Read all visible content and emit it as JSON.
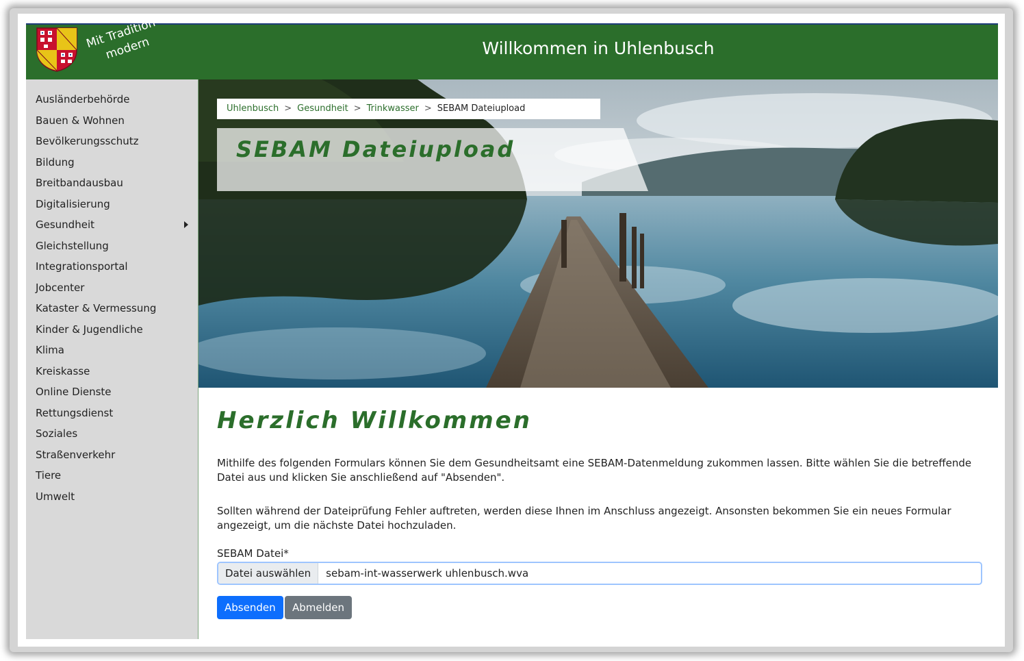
{
  "header": {
    "slogan_line1": "Mit Tradition",
    "slogan_line2": "modern",
    "title": "Willkommen in Uhlenbusch",
    "brand_color": "#2b6e2b"
  },
  "sidebar": {
    "items": [
      {
        "label": "Ausländerbehörde"
      },
      {
        "label": "Bauen & Wohnen"
      },
      {
        "label": "Bevölkerungsschutz"
      },
      {
        "label": "Bildung"
      },
      {
        "label": "Breitbandausbau"
      },
      {
        "label": "Digitalisierung"
      },
      {
        "label": "Gesundheit",
        "has_submenu": true
      },
      {
        "label": "Gleichstellung"
      },
      {
        "label": "Integrationsportal"
      },
      {
        "label": "Jobcenter"
      },
      {
        "label": "Kataster & Vermessung"
      },
      {
        "label": "Kinder & Jugendliche"
      },
      {
        "label": "Klima"
      },
      {
        "label": "Kreiskasse"
      },
      {
        "label": "Online Dienste"
      },
      {
        "label": "Rettungsdienst"
      },
      {
        "label": "Soziales"
      },
      {
        "label": "Straßenverkehr"
      },
      {
        "label": "Tiere"
      },
      {
        "label": "Umwelt"
      }
    ]
  },
  "breadcrumb": {
    "items": [
      "Uhlenbusch",
      "Gesundheit",
      "Trinkwasser"
    ],
    "current": "SEBAM Dateiupload",
    "separator": ">"
  },
  "hero": {
    "title": "SEBAM Dateiupload"
  },
  "main": {
    "welcome": "Herzlich Willkommen",
    "paragraph1": "Mithilfe des folgenden Formulars können Sie dem Gesundheitsamt eine SEBAM-Datenmeldung zukommen lassen. Bitte wählen Sie die betreffende Datei aus und klicken Sie anschließend auf \"Absenden\".",
    "paragraph2": "Sollten während der Dateiprüfung Fehler auftreten, werden diese Ihnen im Anschluss angezeigt. Ansonsten bekommen Sie ein neues Formular angezeigt, um die nächste Datei hochzuladen.",
    "field_label": "SEBAM Datei*",
    "file_button": "Datei auswählen",
    "file_name": "sebam-int-wasserwerk uhlenbusch.wva",
    "submit_label": "Absenden",
    "logout_label": "Abmelden"
  }
}
